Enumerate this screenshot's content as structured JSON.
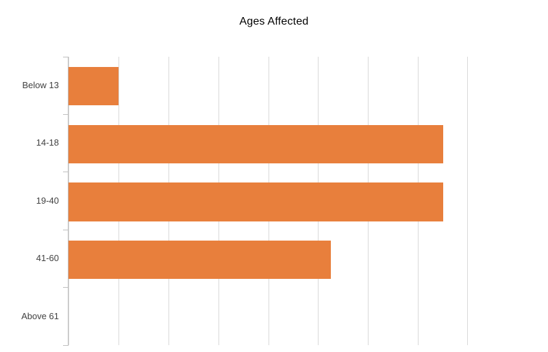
{
  "chart_data": {
    "type": "bar",
    "orientation": "horizontal",
    "title": "Ages Affected",
    "xlabel": "",
    "ylabel": "",
    "categories": [
      "Below 13",
      "14-18",
      "19-40",
      "41-60",
      "Above 61"
    ],
    "values": [
      1,
      7.5,
      7.5,
      5.25,
      0
    ],
    "xlim": [
      0,
      8
    ],
    "ylim": null,
    "gridlines": {
      "axis": "x",
      "visible": true,
      "count": 9,
      "values": [
        0,
        1,
        2,
        3,
        4,
        5,
        6,
        7,
        8
      ]
    },
    "tick_labels": {
      "x": [],
      "y": [
        "Below 13",
        "14-18",
        "19-40",
        "41-60",
        "Above 61"
      ]
    },
    "legend": {
      "visible": false,
      "position": "none",
      "entries": []
    },
    "series": [
      {
        "name": "Ages Affected",
        "color": "#e87f3c",
        "values": [
          1,
          7.5,
          7.5,
          5.25,
          0
        ]
      }
    ],
    "annotations": [],
    "data_labels": {
      "visible": false
    }
  },
  "chart": {
    "title": "Ages Affected",
    "bar_color": "#e87f3c",
    "gridline_color": "#d9d9d9",
    "axis_color": "#bfbfbf",
    "label_color": "#404040",
    "background": "#ffffff"
  }
}
